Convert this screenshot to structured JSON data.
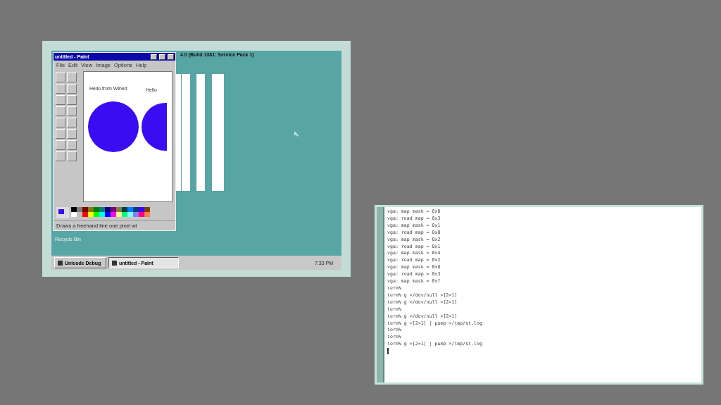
{
  "vm_window": {
    "screen_title": "4.0 (Build 1381: Service Pack 1)",
    "desktop_icons": [
      "Recycle Bin"
    ],
    "paint": {
      "title": "untitled - Paint",
      "menu": [
        "File",
        "Edit",
        "View",
        "Image",
        "Options",
        "Help"
      ],
      "canvas_texts": [
        "Hello from Wined",
        "Hello"
      ],
      "status": "Draws a freehand line one pixel wi"
    },
    "taskbar": {
      "buttons": [
        {
          "label": "Unicode Debug",
          "selected": false
        },
        {
          "label": "untitled - Paint",
          "selected": true
        }
      ],
      "clock": "7:33 PM"
    }
  },
  "terminal": {
    "lines": [
      "vga: map mask = 0x8",
      "vga: read map = 0x3",
      "vga: map mask = 0x1",
      "vga: read map = 0x0",
      "vga: map mask = 0x2",
      "vga: read map = 0x1",
      "vga: map mask = 0x4",
      "vga: read map = 0x2",
      "vga: map mask = 0x8",
      "vga: read map = 0x3",
      "vga: map mask = 0xf",
      "term%",
      "term% g </dev/null >[2=1]",
      "term% g </dev/null >[2=1]",
      "term%",
      "term% g </dev/null >[2=1]",
      "term% g >[2=1] | pump >/tmp/st.log",
      "term%",
      "term%",
      "term% g >[2=1] | pump >/tmp/st.log"
    ]
  }
}
